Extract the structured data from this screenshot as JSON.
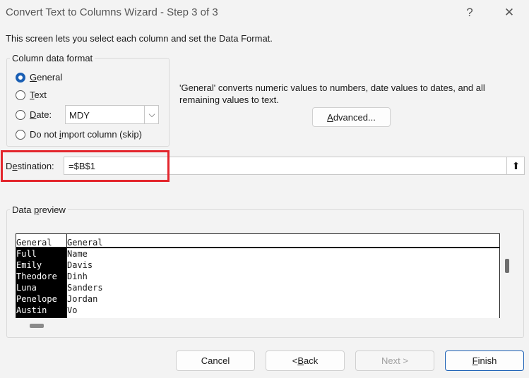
{
  "window": {
    "title": "Convert Text to Columns Wizard - Step 3 of 3",
    "help_glyph": "?",
    "close_glyph": "✕"
  },
  "intro_text": "This screen lets you select each column and set the Data Format.",
  "format_group": {
    "label": "Column data format",
    "general": {
      "pre": "",
      "key": "G",
      "post": "eneral"
    },
    "text": {
      "pre": "",
      "key": "T",
      "post": "ext"
    },
    "date": {
      "pre": "",
      "key": "D",
      "post": "ate:"
    },
    "skip": {
      "pre": "Do not ",
      "key": "i",
      "post": "mport column (skip)"
    },
    "selected": "general",
    "date_format_value": "MDY",
    "dropdown_glyph": "⌵"
  },
  "description": {
    "line1": "'General' converts numeric values to numbers, date values to dates, and all",
    "line2": "remaining values to text."
  },
  "advanced_button": {
    "pre": "",
    "key": "A",
    "post": "dvanced..."
  },
  "destination": {
    "label_pre": "D",
    "label_key": "e",
    "label_post": "stination:",
    "value": "=$B$1",
    "collapse_glyph": "⬆"
  },
  "highlight_color": "#e3262d",
  "preview": {
    "label_pre": "Data ",
    "label_key": "p",
    "label_post": "review",
    "headers": [
      "General",
      "General"
    ],
    "col1": [
      "Full",
      "Emily",
      "Theodore",
      "Luna",
      "Penelope",
      "Austin"
    ],
    "col2": [
      "Name",
      "Davis",
      "Dinh",
      "Sanders",
      "Jordan",
      "Vo"
    ]
  },
  "buttons": {
    "cancel": "Cancel",
    "back": {
      "pre": "< ",
      "key": "B",
      "post": "ack"
    },
    "next": "Next >",
    "finish": {
      "pre": "",
      "key": "F",
      "post": "inish"
    }
  }
}
